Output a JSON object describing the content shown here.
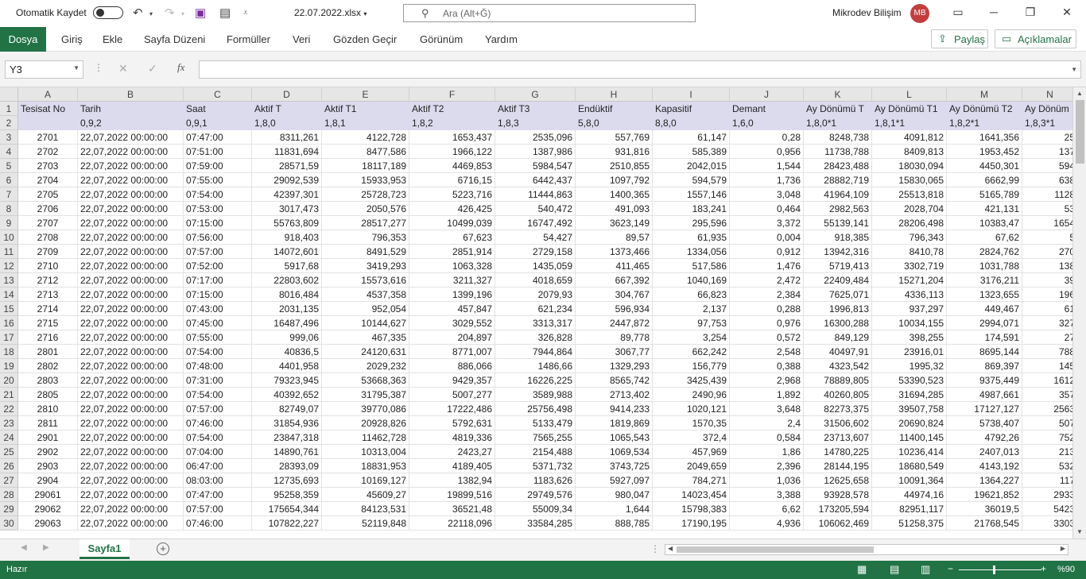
{
  "titlebar": {
    "autosave_label": "Otomatik Kaydet",
    "filename": "22.07.2022.xlsx",
    "search_placeholder": "Ara (Alt+Ğ)",
    "user_name": "Mikrodev Bilişim",
    "user_initials": "MB"
  },
  "ribbon": {
    "tabs": [
      "Dosya",
      "Giriş",
      "Ekle",
      "Sayfa Düzeni",
      "Formüller",
      "Veri",
      "Gözden Geçir",
      "Görünüm",
      "Yardım"
    ],
    "share_label": "Paylaş",
    "comments_label": "Açıklamalar"
  },
  "formula_bar": {
    "name_box": "Y3",
    "fx_label": "fx",
    "formula": ""
  },
  "sheet": {
    "columns": [
      "A",
      "B",
      "C",
      "D",
      "E",
      "F",
      "G",
      "H",
      "I",
      "J",
      "K",
      "L",
      "M",
      "N"
    ],
    "header_row": [
      "Tesisat No",
      "Tarih",
      "Saat",
      "Aktif T",
      "Aktif T1",
      "Aktif T2",
      "Aktif T3",
      "Endüktif",
      "Kapasitif",
      "Demant",
      "Ay Dönümü T",
      "Ay Dönümü T1",
      "Ay Dönümü T2",
      "Ay Dönüm"
    ],
    "code_row": [
      "",
      "0,9,2",
      "0,9,1",
      "1,8,0",
      "1,8,1",
      "1,8,2",
      "1,8,3",
      "5,8,0",
      "8,8,0",
      "1,6,0",
      "1,8,0*1",
      "1,8,1*1",
      "1,8,2*1",
      "1,8,3*1"
    ],
    "rows": [
      [
        "2701",
        "22,07,2022 00:00:00",
        "07:47:00",
        "8311,261",
        "4122,728",
        "1653,437",
        "2535,096",
        "557,769",
        "61,147",
        "0,28",
        "8248,738",
        "4091,812",
        "1641,356",
        "25"
      ],
      [
        "2702",
        "22,07,2022 00:00:00",
        "07:51:00",
        "11831,694",
        "8477,586",
        "1966,122",
        "1387,986",
        "931,816",
        "585,389",
        "0,956",
        "11738,788",
        "8409,813",
        "1953,452",
        "137"
      ],
      [
        "2703",
        "22,07,2022 00:00:00",
        "07:59:00",
        "28571,59",
        "18117,189",
        "4469,853",
        "5984,547",
        "2510,855",
        "2042,015",
        "1,544",
        "28423,488",
        "18030,094",
        "4450,301",
        "594"
      ],
      [
        "2704",
        "22,07,2022 00:00:00",
        "07:55:00",
        "29092,539",
        "15933,953",
        "6716,15",
        "6442,437",
        "1097,792",
        "594,579",
        "1,736",
        "28882,719",
        "15830,065",
        "6662,99",
        "638"
      ],
      [
        "2705",
        "22,07,2022 00:00:00",
        "07:54:00",
        "42397,301",
        "25728,723",
        "5223,716",
        "11444,863",
        "1400,365",
        "1557,146",
        "3,048",
        "41964,109",
        "25513,818",
        "5165,789",
        "1128"
      ],
      [
        "2706",
        "22,07,2022 00:00:00",
        "07:53:00",
        "3017,473",
        "2050,576",
        "426,425",
        "540,472",
        "491,093",
        "183,241",
        "0,464",
        "2982,563",
        "2028,704",
        "421,131",
        "53"
      ],
      [
        "2707",
        "22,07,2022 00:00:00",
        "07:15:00",
        "55763,809",
        "28517,277",
        "10499,039",
        "16747,492",
        "3623,149",
        "295,596",
        "3,372",
        "55139,141",
        "28206,498",
        "10383,47",
        "1654"
      ],
      [
        "2708",
        "22,07,2022 00:00:00",
        "07:56:00",
        "918,403",
        "796,353",
        "67,623",
        "54,427",
        "89,57",
        "61,935",
        "0,004",
        "918,385",
        "796,343",
        "67,62",
        "5"
      ],
      [
        "2709",
        "22,07,2022 00:00:00",
        "07:57:00",
        "14072,601",
        "8491,529",
        "2851,914",
        "2729,158",
        "1373,466",
        "1334,056",
        "0,912",
        "13942,316",
        "8410,78",
        "2824,762",
        "270"
      ],
      [
        "2710",
        "22,07,2022 00:00:00",
        "07:52:00",
        "5917,68",
        "3419,293",
        "1063,328",
        "1435,059",
        "411,465",
        "517,586",
        "1,476",
        "5719,413",
        "3302,719",
        "1031,788",
        "138"
      ],
      [
        "2712",
        "22,07,2022 00:00:00",
        "07:17:00",
        "22803,602",
        "15573,616",
        "3211,327",
        "4018,659",
        "667,392",
        "1040,169",
        "2,472",
        "22409,484",
        "15271,204",
        "3176,211",
        "39"
      ],
      [
        "2713",
        "22,07,2022 00:00:00",
        "07:15:00",
        "8016,484",
        "4537,358",
        "1399,196",
        "2079,93",
        "304,767",
        "66,823",
        "2,384",
        "7625,071",
        "4336,113",
        "1323,655",
        "196"
      ],
      [
        "2714",
        "22,07,2022 00:00:00",
        "07:43:00",
        "2031,135",
        "952,054",
        "457,847",
        "621,234",
        "596,934",
        "2,137",
        "0,288",
        "1996,813",
        "937,297",
        "449,467",
        "61"
      ],
      [
        "2715",
        "22,07,2022 00:00:00",
        "07:45:00",
        "16487,496",
        "10144,627",
        "3029,552",
        "3313,317",
        "2447,872",
        "97,753",
        "0,976",
        "16300,288",
        "10034,155",
        "2994,071",
        "327"
      ],
      [
        "2716",
        "22,07,2022 00:00:00",
        "07:55:00",
        "999,06",
        "467,335",
        "204,897",
        "326,828",
        "89,778",
        "3,254",
        "0,572",
        "849,129",
        "398,255",
        "174,591",
        "27"
      ],
      [
        "2801",
        "22,07,2022 00:00:00",
        "07:54:00",
        "40836,5",
        "24120,631",
        "8771,007",
        "7944,864",
        "3067,77",
        "662,242",
        "2,548",
        "40497,91",
        "23916,01",
        "8695,144",
        "788"
      ],
      [
        "2802",
        "22,07,2022 00:00:00",
        "07:48:00",
        "4401,958",
        "2029,232",
        "886,066",
        "1486,66",
        "1329,293",
        "156,779",
        "0,388",
        "4323,542",
        "1995,32",
        "869,397",
        "145"
      ],
      [
        "2803",
        "22,07,2022 00:00:00",
        "07:31:00",
        "79323,945",
        "53668,363",
        "9429,357",
        "16226,225",
        "8565,742",
        "3425,439",
        "2,968",
        "78889,805",
        "53390,523",
        "9375,449",
        "1612"
      ],
      [
        "2805",
        "22,07,2022 00:00:00",
        "07:54:00",
        "40392,652",
        "31795,387",
        "5007,277",
        "3589,988",
        "2713,402",
        "2490,96",
        "1,892",
        "40260,805",
        "31694,285",
        "4987,661",
        "357"
      ],
      [
        "2810",
        "22,07,2022 00:00:00",
        "07:57:00",
        "82749,07",
        "39770,086",
        "17222,486",
        "25756,498",
        "9414,233",
        "1020,121",
        "3,648",
        "82273,375",
        "39507,758",
        "17127,127",
        "2563"
      ],
      [
        "2811",
        "22,07,2022 00:00:00",
        "07:46:00",
        "31854,936",
        "20928,826",
        "5792,631",
        "5133,479",
        "1819,869",
        "1570,35",
        "2,4",
        "31506,602",
        "20690,824",
        "5738,407",
        "507"
      ],
      [
        "2901",
        "22,07,2022 00:00:00",
        "07:54:00",
        "23847,318",
        "11462,728",
        "4819,336",
        "7565,255",
        "1065,543",
        "372,4",
        "0,584",
        "23713,607",
        "11400,145",
        "4792,26",
        "752"
      ],
      [
        "2902",
        "22,07,2022 00:00:00",
        "07:04:00",
        "14890,761",
        "10313,004",
        "2423,27",
        "2154,488",
        "1069,534",
        "457,969",
        "1,86",
        "14780,225",
        "10236,414",
        "2407,013",
        "213"
      ],
      [
        "2903",
        "22,07,2022 00:00:00",
        "06:47:00",
        "28393,09",
        "18831,953",
        "4189,405",
        "5371,732",
        "3743,725",
        "2049,659",
        "2,396",
        "28144,195",
        "18680,549",
        "4143,192",
        "532"
      ],
      [
        "2904",
        "22,07,2022 00:00:00",
        "08:03:00",
        "12735,693",
        "10169,127",
        "1382,94",
        "1183,626",
        "5927,097",
        "784,271",
        "1,036",
        "12625,658",
        "10091,364",
        "1364,227",
        "117"
      ],
      [
        "29061",
        "22,07,2022 00:00:00",
        "07:47:00",
        "95258,359",
        "45609,27",
        "19899,516",
        "29749,576",
        "980,047",
        "14023,454",
        "3,388",
        "93928,578",
        "44974,16",
        "19621,852",
        "2933"
      ],
      [
        "29062",
        "22,07,2022 00:00:00",
        "07:57:00",
        "175654,344",
        "84123,531",
        "36521,48",
        "55009,34",
        "1,644",
        "15798,383",
        "6,62",
        "173205,594",
        "82951,117",
        "36019,5",
        "5423"
      ],
      [
        "29063",
        "22,07,2022 00:00:00",
        "07:46:00",
        "107822,227",
        "52119,848",
        "22118,096",
        "33584,285",
        "888,785",
        "17190,195",
        "4,936",
        "106062,469",
        "51258,375",
        "21768,545",
        "3303"
      ]
    ]
  },
  "sheet_tab": "Sayfa1",
  "status": {
    "ready": "Hazır",
    "zoom": "%90"
  }
}
